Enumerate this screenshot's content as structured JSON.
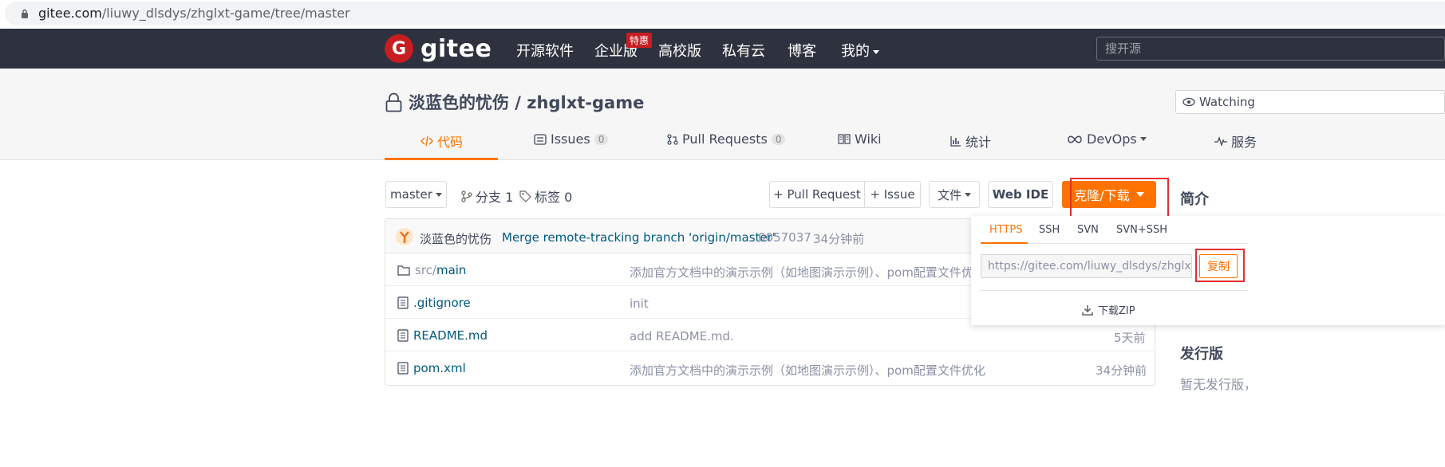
{
  "browser": {
    "url_domain": "gitee.com",
    "url_path": "/liuwy_dlsdys/zhglxt-game/tree/master"
  },
  "nav": {
    "logo_letter": "G",
    "logo_text": "gitee",
    "items": [
      "开源软件",
      "企业版",
      "高校版",
      "私有云",
      "博客",
      "我的"
    ],
    "hot_badge": "特惠",
    "search_placeholder": "搜开源"
  },
  "project": {
    "title": "淡蓝色的忧伤 / zhglxt-game",
    "watch_label": "Watching",
    "tabs": [
      {
        "label": "代码"
      },
      {
        "label": "Issues",
        "count": "0"
      },
      {
        "label": "Pull Requests",
        "count": "0"
      },
      {
        "label": "Wiki"
      },
      {
        "label": "统计"
      },
      {
        "label": "DevOps"
      },
      {
        "label": "服务"
      }
    ]
  },
  "toolbar": {
    "branch": "master",
    "branches": "分支 1",
    "tags": "标签 0",
    "pull_request": "+ Pull Request",
    "issue": "+ Issue",
    "file": "文件",
    "web_ide": "Web IDE",
    "clone": "克隆/下载"
  },
  "commit": {
    "author": "淡蓝色的忧伤",
    "message": "Merge remote-tracking branch 'origin/master'",
    "hash": "0057037",
    "time": "34分钟前"
  },
  "files": [
    {
      "prefix": "src/",
      "name": "main",
      "message": "添加官方文档中的演示示例（如地图演示示例）、pom配置文件优化",
      "time": ""
    },
    {
      "prefix": "",
      "name": ".gitignore",
      "message": "init",
      "time": ""
    },
    {
      "prefix": "",
      "name": "README.md",
      "message": "add README.md.",
      "time": "5天前"
    },
    {
      "prefix": "",
      "name": "pom.xml",
      "message": "添加官方文档中的演示示例（如地图演示示例）、pom配置文件优化",
      "time": "34分钟前"
    }
  ],
  "clone_dropdown": {
    "tabs": [
      "HTTPS",
      "SSH",
      "SVN",
      "SVN+SSH"
    ],
    "url": "https://gitee.com/liuwy_dlsdys/zhglxt-game.git",
    "copy_label": "复制",
    "zip_label": "下载ZIP"
  },
  "sidebar": {
    "intro_title": "简介",
    "release_title": "发行版",
    "release_text": "暂无发行版，"
  },
  "colors": {
    "accent": "#fe7300",
    "nav_bg": "#2e323e",
    "brand_red": "#c71d23",
    "link": "#005980",
    "highlight_box": "#e52e2e"
  }
}
